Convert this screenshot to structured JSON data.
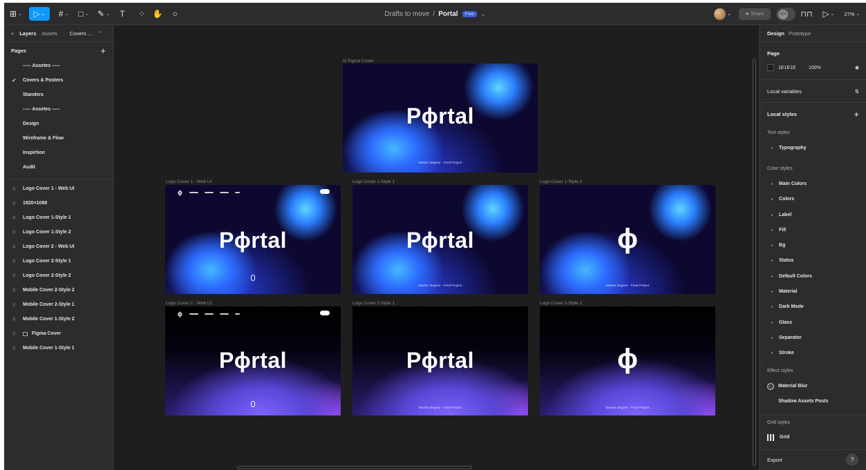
{
  "toolbar": {
    "main_menu_icon": "figma-logo-icon",
    "tools": [
      "move",
      "frame",
      "shape",
      "pen",
      "text",
      "resources",
      "hand",
      "comment"
    ],
    "text_tool": "T",
    "zoom": "27%",
    "share_label": "Share"
  },
  "title": {
    "project": "Drafts to move",
    "separator": "/",
    "file": "Portal",
    "badge": "Free"
  },
  "left": {
    "tabs": {
      "layers": "Layers",
      "assets": "Assets",
      "page": "Covers ..."
    },
    "pages_title": "Pages",
    "pages": [
      "----- Assetes -----",
      "Covers & Posters",
      "Standers",
      "----- Assetes -----",
      "Design",
      "Wireframe & Flow",
      "Inspirtion",
      "Audit"
    ],
    "check": "✓",
    "layers": [
      "Logo Cover 1 - Web UI",
      "1920×1088",
      "Logo Cover 1-Style 1",
      "Logo Cover 1-Style 2",
      "Logo Cover 2 - Web UI",
      "Logo Cover 2-Style 1",
      "Logo Cover 2-Style 2",
      "Mobile Cover 2-Style 2",
      "Mobile Cover 2-Style 1",
      "Mobile Cover 1-Style 2",
      "Figma Cover",
      "Mobile Cover 1-Style 1"
    ],
    "hash": "#"
  },
  "canvas": {
    "figma_cover_label": "Figma Cover",
    "labels": [
      "Logo Cover 1 - Web UI",
      "Logo Cover 1-Style 1",
      "Logo Cover 1-Style 2",
      "Logo Cover 2 - Web UI",
      "Logo Cover 2-Style 1",
      "Logo Cover 2-Style 2"
    ],
    "portal_word": "Pɸrtal",
    "logo_glyph": "ɸ",
    "caption": "Master Degree - Final Project"
  },
  "right": {
    "tabs": {
      "design": "Design",
      "prototype": "Prototype"
    },
    "page_title": "Page",
    "page_color": "1E1E1E",
    "page_opacity": "100%",
    "local_variables": "Local variables",
    "local_styles": "Local styles",
    "text_styles": "Text styles",
    "text_style_items": [
      "Typography"
    ],
    "color_styles": "Color styles",
    "color_items": [
      "Main Colors",
      "Colors",
      "Label",
      "Fill",
      "Bg",
      "Status",
      "Default Colors",
      "Material",
      "Dark Mode",
      "Glass",
      "Separator",
      "Stroke"
    ],
    "effect_styles": "Effect styles",
    "effect_items": [
      "Material Blur",
      "Shadow Assets Posts"
    ],
    "grid_styles": "Grid styles",
    "grid_items": [
      "Grid"
    ],
    "export": "Export",
    "help": "?"
  }
}
